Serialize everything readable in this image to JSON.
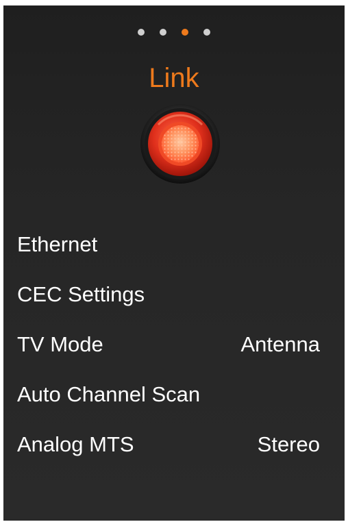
{
  "pager": {
    "count": 4,
    "active_index": 2
  },
  "page": {
    "title": "Link",
    "title_color": "#ee7a1c",
    "icon": "link-speaker-icon"
  },
  "menu": {
    "items": [
      {
        "label": "Ethernet",
        "value": ""
      },
      {
        "label": "CEC Settings",
        "value": ""
      },
      {
        "label": "TV Mode",
        "value": "Antenna"
      },
      {
        "label": "Auto Channel Scan",
        "value": ""
      },
      {
        "label": "Analog MTS",
        "value": "Stereo"
      }
    ]
  }
}
